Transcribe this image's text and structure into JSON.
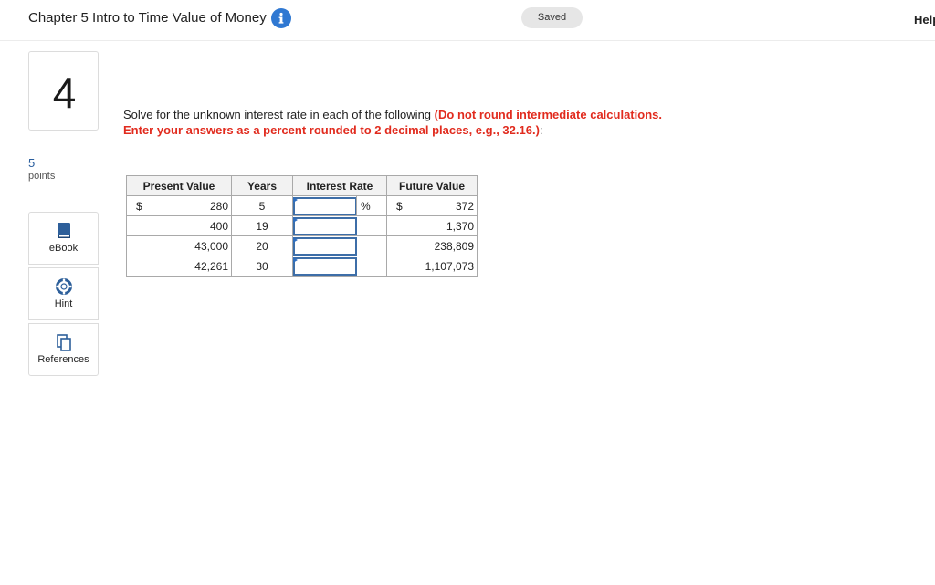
{
  "header": {
    "title": "Chapter 5 Intro to Time Value of Money",
    "saved_label": "Saved",
    "help_label": "Help"
  },
  "question": {
    "number": "4",
    "points_value": "5",
    "points_label": "points",
    "text_plain": "Solve for the unknown interest rate in each of the following",
    "text_emphasis": "(Do not round intermediate calculations. Enter your answers as a percent rounded to 2 decimal places, e.g., 32.16.)",
    "text_tail": ":"
  },
  "tools": {
    "ebook_label": "eBook",
    "hint_label": "Hint",
    "references_label": "References"
  },
  "table": {
    "headers": {
      "present_value": "Present Value",
      "years": "Years",
      "interest_rate": "Interest Rate",
      "future_value": "Future Value"
    },
    "currency_symbol": "$",
    "percent_symbol": "%",
    "rows": [
      {
        "pv": "280",
        "years": "5",
        "rate": "",
        "fv": "372"
      },
      {
        "pv": "400",
        "years": "19",
        "rate": "",
        "fv": "1,370"
      },
      {
        "pv": "43,000",
        "years": "20",
        "rate": "",
        "fv": "238,809"
      },
      {
        "pv": "42,261",
        "years": "30",
        "rate": "",
        "fv": "1,107,073"
      }
    ]
  },
  "colors": {
    "accent_blue": "#2f78d2",
    "emphasis_red": "#e12b1e",
    "points_blue": "#2a5e9e"
  }
}
